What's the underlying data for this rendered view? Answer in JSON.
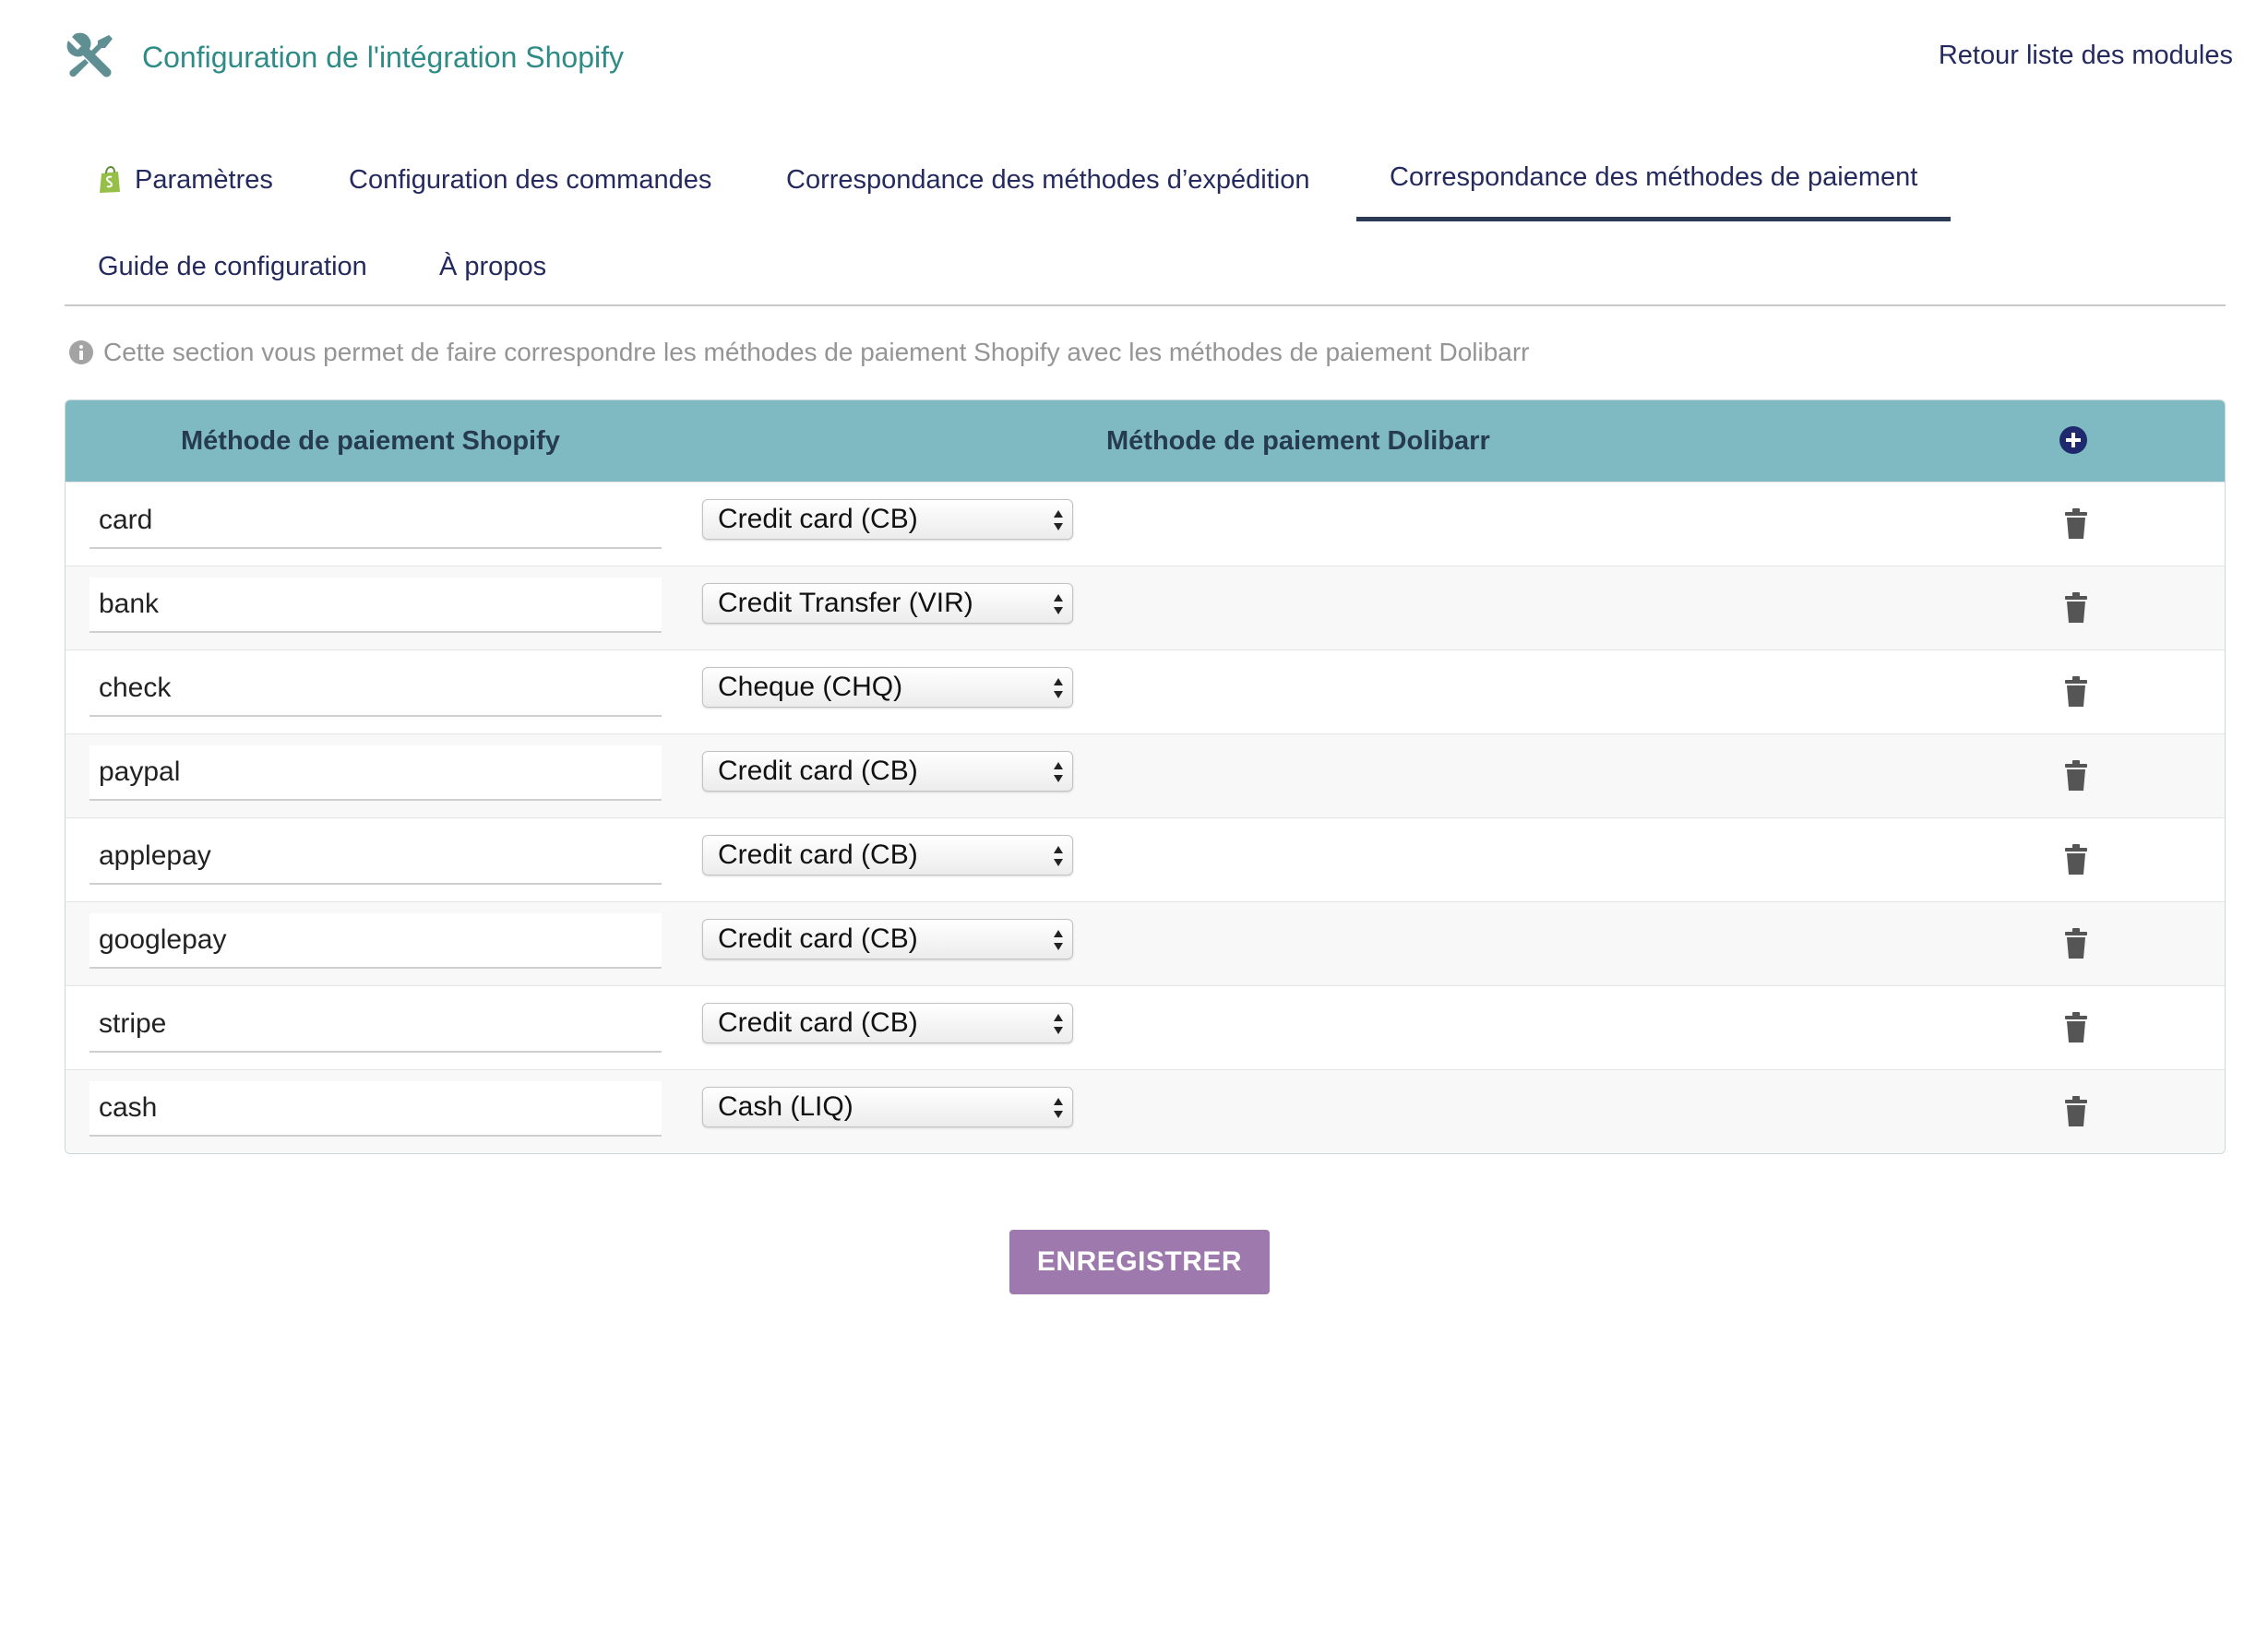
{
  "header": {
    "title": "Configuration de l'intégration Shopify",
    "title_icon": "tools-icon",
    "back_link": "Retour liste des modules"
  },
  "tabs": [
    {
      "label": "Paramètres",
      "icon": "shopify-bag-icon",
      "active": false
    },
    {
      "label": "Configuration des commandes",
      "active": false
    },
    {
      "label": "Correspondance des méthodes d’expédition",
      "active": false
    },
    {
      "label": "Correspondance des méthodes de paiement",
      "active": true
    },
    {
      "label": "Guide de configuration",
      "active": false
    },
    {
      "label": "À propos",
      "active": false
    }
  ],
  "info": {
    "icon": "info-icon",
    "text": "Cette section vous permet de faire correspondre les méthodes de paiement Shopify avec les méthodes de paiement Dolibarr"
  },
  "table": {
    "columns": {
      "shopify": "Méthode de paiement Shopify",
      "dolibarr": "Méthode de paiement Dolibarr"
    },
    "add_icon": "plus-circle-icon",
    "delete_icon": "trash-icon",
    "rows": [
      {
        "shopify": "card",
        "dolibarr": "Credit card (CB)"
      },
      {
        "shopify": "bank",
        "dolibarr": "Credit Transfer (VIR)"
      },
      {
        "shopify": "check",
        "dolibarr": "Cheque (CHQ)"
      },
      {
        "shopify": "paypal",
        "dolibarr": "Credit card (CB)"
      },
      {
        "shopify": "applepay",
        "dolibarr": "Credit card (CB)"
      },
      {
        "shopify": "googlepay",
        "dolibarr": "Credit card (CB)"
      },
      {
        "shopify": "stripe",
        "dolibarr": "Credit card (CB)"
      },
      {
        "shopify": "cash",
        "dolibarr": "Cash (LIQ)"
      }
    ]
  },
  "save_label": "ENREGISTRER",
  "colors": {
    "accent_title": "#2e8b86",
    "link": "#252a5e",
    "table_header": "#7fbac2",
    "save_button": "#9d79ad",
    "active_tab_underline": "#2b3a55"
  }
}
